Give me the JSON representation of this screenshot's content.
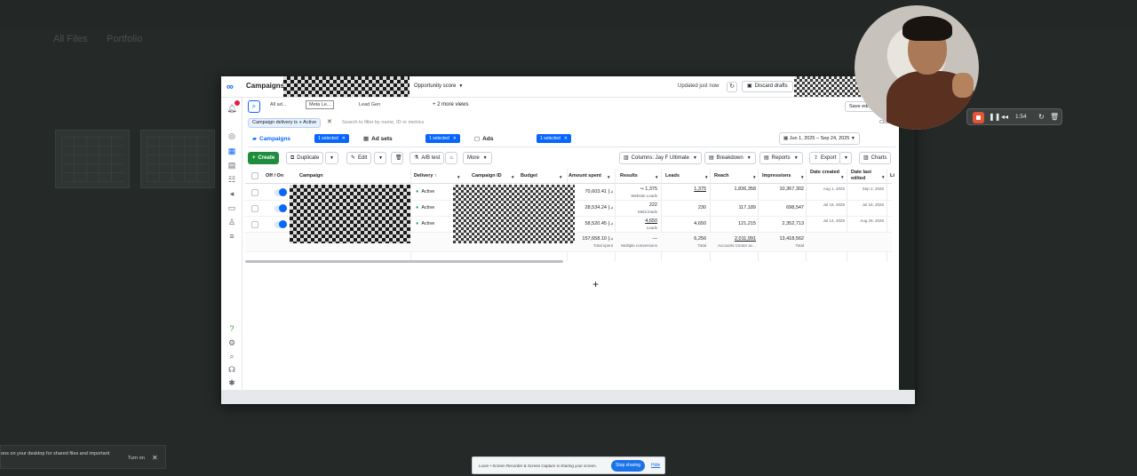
{
  "background": {
    "labels": [
      "All Files",
      "Portfolio"
    ]
  },
  "topbar": {
    "title": "Campaigns",
    "opportunity_score": "Opportunity score",
    "updated": "Updated just now",
    "discard_drafts": "Discard drafts"
  },
  "views": {
    "tabs": [
      "All ad...",
      "Meta Le...",
      "Lead Gen"
    ],
    "more_views": "2 more views",
    "save_edit": "Save edit"
  },
  "filter": {
    "chip_prefix": "Campaign delivery is",
    "chip_value": "Active",
    "search_placeholder": "Search to filter by name, ID or metrics",
    "close_label": "Clos"
  },
  "levels": {
    "campaigns": "Campaigns",
    "campaigns_selected": "1 selected",
    "adsets": "Ad sets",
    "adsets_selected": "1 selected",
    "ads": "Ads",
    "ads_selected": "1 selected",
    "date_range": "Jun 1, 2025 – Sep 24, 2025"
  },
  "toolbar": {
    "create": "Create",
    "duplicate": "Duplicate",
    "edit": "Edit",
    "ab_test": "A/B test",
    "more": "More",
    "columns": "Columns: Jay F Ultimate",
    "breakdown": "Breakdown",
    "reports": "Reports",
    "export": "Export",
    "charts": "Charts"
  },
  "table": {
    "headers": {
      "off_on": "Off / On",
      "campaign": "Campaign",
      "delivery": "Delivery ↑",
      "campaign_id": "Campaign ID",
      "budget": "Budget",
      "amount_spent": "Amount spent",
      "results": "Results",
      "leads": "Leads",
      "reach": "Reach",
      "impressions": "Impressions",
      "date_created": "Date created",
      "date_last_edited": "Date last edited",
      "extra": "Li"
    },
    "rows": [
      {
        "delivery": "Active",
        "amount_spent": "70,603.41 د.إ",
        "results": "1,375",
        "results_sub": "Website Leads",
        "leads": "1,375",
        "reach": "1,836,358",
        "impressions": "10,367,302",
        "date_created": "Aug 1, 2025",
        "date_last_edited": "Sep 2, 2025"
      },
      {
        "delivery": "Active",
        "amount_spent": "28,534.24 د.إ",
        "results": "222",
        "results_sub": "Meta leads",
        "leads": "230",
        "reach": "117,189",
        "impressions": "698,547",
        "date_created": "Jul 16, 2025",
        "date_last_edited": "Jul 16, 2025"
      },
      {
        "delivery": "Active",
        "amount_spent": "58,520.45 د.إ",
        "results": "4,650",
        "results_sub": "Leads",
        "leads": "4,650",
        "reach": "121,215",
        "impressions": "2,352,713",
        "date_created": "Jul 14, 2025",
        "date_last_edited": "Aug 29, 2025"
      }
    ],
    "total": {
      "amount_spent": "157,658.10 د.إ",
      "amount_spent_sub": "Total spent",
      "results": "—",
      "results_sub": "Multiple conversions",
      "leads": "6,256",
      "leads_sub": "Total",
      "reach": "2,011,991",
      "reach_sub": "Accounts Center ac...",
      "impressions": "13,418,562",
      "impressions_sub": "Total"
    }
  },
  "recorder": {
    "time": "1:54"
  },
  "toast": {
    "text": "ons on your desktop for shared files and important",
    "button": "Turn on"
  },
  "share_bar": {
    "text": "Loom • Screen Recorder & Screen Capture is sharing your screen.",
    "stop": "Stop sharing",
    "hide": "Hide"
  },
  "colors": {
    "accent": "#0866ff",
    "create_green": "#1e8e3e",
    "active_dot": "#31a24c",
    "record_red": "#e45535"
  }
}
